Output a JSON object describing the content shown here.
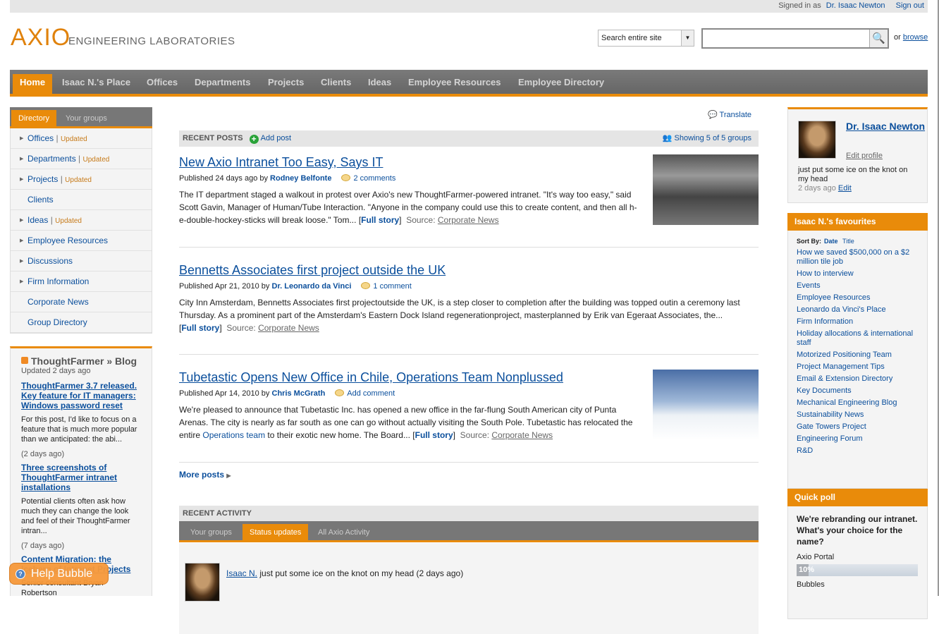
{
  "topbar": {
    "signed_in_prefix": "Signed in as",
    "user": "Dr. Isaac Newton",
    "sign_out": "Sign out"
  },
  "brand": {
    "logo": "AXIO",
    "subtitle": "ENGINEERING LABORATORIES",
    "accent": "#e98b0a"
  },
  "search": {
    "scope": "Search entire site",
    "value": "",
    "or": "or",
    "browse": "browse",
    "icon": "magnifier-icon"
  },
  "nav": [
    "Home",
    "Isaac N.'s Place",
    "Offices",
    "Departments",
    "Projects",
    "Clients",
    "Ideas",
    "Employee Resources",
    "Employee Directory"
  ],
  "left": {
    "tabs": [
      "Directory",
      "Your groups"
    ],
    "items": [
      {
        "label": "Offices",
        "updated": "Updated",
        "arrow": true
      },
      {
        "label": "Departments",
        "updated": "Updated",
        "arrow": true
      },
      {
        "label": "Projects",
        "updated": "Updated",
        "arrow": true
      },
      {
        "label": "Clients",
        "arrow": false
      },
      {
        "label": "Ideas",
        "updated": "Updated",
        "arrow": true
      },
      {
        "label": "Employee Resources",
        "arrow": true
      },
      {
        "label": "Discussions",
        "arrow": true
      },
      {
        "label": "Firm Information",
        "arrow": true
      },
      {
        "label": "Corporate News",
        "arrow": false
      },
      {
        "label": "Group Directory",
        "arrow": false
      }
    ],
    "blog": {
      "title": "ThoughtFarmer » Blog",
      "updated": "Updated 2 days ago",
      "posts": [
        {
          "title": "ThoughtFarmer 3.7 released. Key feature for IT managers: Windows password reset",
          "excerpt": "For this post, I'd like to focus on a feature that is much more popular than we anticipated: the abi...",
          "ago": "(2 days ago)"
        },
        {
          "title": "Three screenshots of ThoughtFarmer intranet installations",
          "excerpt": "Potential clients often ask how much they can change the look and feel of their ThoughtFarmer intran...",
          "ago": "(7 days ago)"
        },
        {
          "title": "Content Migration: the Iceberg of Intranet Projects",
          "excerpt": "Senior consultant Bryan Robertson"
        }
      ]
    },
    "help": "Help Bubble"
  },
  "main": {
    "translate": "Translate",
    "recent_posts": "RECENT POSTS",
    "add_post": "Add post",
    "showing": "Showing 5 of 5 groups",
    "posts": [
      {
        "title": "New Axio Intranet Too Easy, Says IT",
        "published": "Published 24 days ago by",
        "author": "Rodney Belfonte",
        "comments": "2 comments",
        "body": "The IT department staged a walkout in protest over Axio's new ThoughtFarmer-powered intranet. \"It's way too easy,\" said Scott Gavin, Manager of Human/Tube Interaction. \"Anyone in the company could use this to create content, and then all h-e-double-hockey-sticks will break loose.\" Tom...",
        "full": "Full story",
        "source_label": "Source:",
        "source": "Corporate News"
      },
      {
        "title": "Bennetts Associates first project outside the UK",
        "published": "Published Apr 21, 2010 by",
        "author": "Dr. Leonardo da Vinci",
        "comments": "1 comment",
        "body": "City Inn Amsterdam, Bennetts Associates first projectoutside the UK, is a step closer to completion after the building was topped outin a ceremony last Thursday. As a prominent part of the Amsterdam's Eastern Dock Island regenerationproject, masterplanned by Erik van Egeraat Associates, the...",
        "full": "Full story",
        "source_label": "Source:",
        "source": "Corporate News"
      },
      {
        "title": "Tubetastic Opens New Office in Chile, Operations Team Nonplussed",
        "published": "Published Apr 14, 2010 by",
        "author": "Chris McGrath",
        "comments": "Add comment",
        "body_pre": "We're pleased to announce that Tubetastic Inc. has opened a new office in the far-flung South American city of Punta Arenas. The city is nearly as far south as one can go without actually visiting the South Pole. Tubetastic has relocated the entire ",
        "body_link": "Operations team",
        "body_post": " to their exotic new home. The Board...",
        "full": "Full story",
        "source_label": "Source:",
        "source": "Corporate News"
      }
    ],
    "more": "More posts",
    "activity": {
      "title": "RECENT ACTIVITY",
      "tabs": [
        "Your groups",
        "Status updates",
        "All Axio Activity"
      ],
      "user": "Isaac N.",
      "text": "just put some ice on the knot on my head (2 days ago)"
    }
  },
  "right": {
    "profile": {
      "name": "Dr. Isaac Newton",
      "edit": "Edit profile",
      "status": "just put some ice on the knot on my head",
      "time": "2 days ago",
      "edit_status": "Edit"
    },
    "favourites": {
      "title": "Isaac N.'s favourites",
      "sort_by": "Sort By:",
      "sort_opts": [
        "Date",
        "Title"
      ],
      "items": [
        "How we saved $500,000 on a $2 million tile job",
        "How to interview",
        "Events",
        "Employee Resources",
        "Leonardo da Vinci's Place",
        "Firm Information",
        "Holiday allocations & international staff",
        "Motorized Positioning Team",
        "Project Management Tips",
        "Email & Extension Directory",
        "Key Documents",
        "Mechanical Engineering Blog",
        "Sustainability News",
        "Gate Towers Project",
        "Engineering Forum",
        "R&D"
      ]
    },
    "poll": {
      "title": "Quick poll",
      "question": "We're rebranding our intranet. What's your choice for the name?",
      "options": [
        {
          "label": "Axio Portal",
          "percent": 10,
          "percent_label": "10%"
        },
        {
          "label": "Bubbles"
        }
      ]
    }
  }
}
